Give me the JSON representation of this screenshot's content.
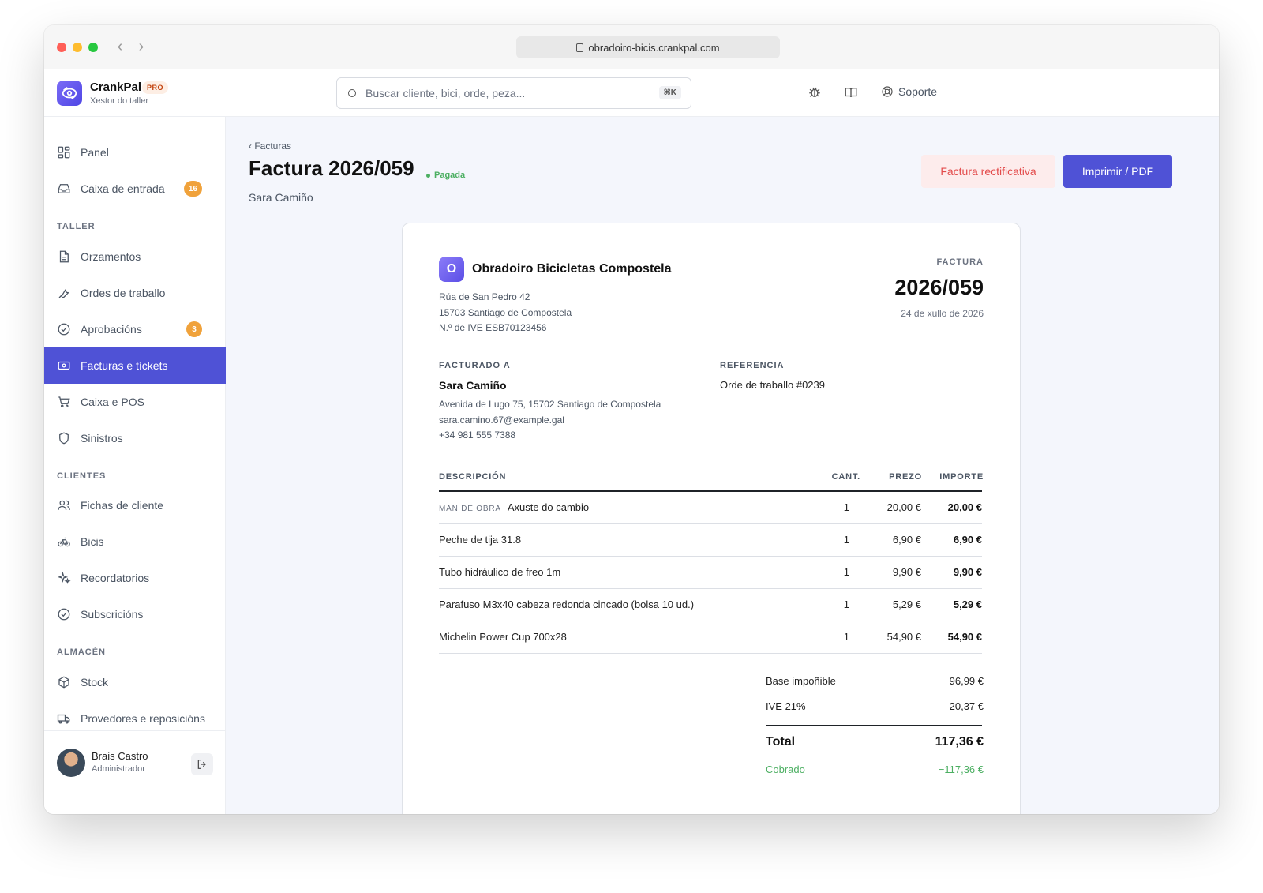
{
  "browser": {
    "url": "obradoiro-bicis.crankpal.com"
  },
  "app": {
    "name": "CrankPal",
    "plan_badge": "PRO",
    "subtitle": "Xestor do taller"
  },
  "search": {
    "placeholder": "Buscar cliente, bici, orde, peza...",
    "shortcut": "⌘K"
  },
  "header": {
    "support_label": "Soporte"
  },
  "sidebar": {
    "items": [
      {
        "label": "Panel",
        "icon": "grid-icon"
      },
      {
        "label": "Caixa de entrada",
        "icon": "inbox-icon",
        "badge": "16"
      },
      {
        "label": "Orzamentos",
        "icon": "document-icon"
      },
      {
        "label": "Ordes de traballo",
        "icon": "wrench-icon"
      },
      {
        "label": "Aprobacións",
        "icon": "check-circle-icon",
        "badge": "3"
      },
      {
        "label": "Facturas e tíckets",
        "icon": "banknote-icon",
        "active": true
      },
      {
        "label": "Caixa e POS",
        "icon": "cart-icon"
      },
      {
        "label": "Sinistros",
        "icon": "shield-icon"
      },
      {
        "label": "Fichas de cliente",
        "icon": "users-icon"
      },
      {
        "label": "Bicis",
        "icon": "bike-icon"
      },
      {
        "label": "Recordatorios",
        "icon": "sparkle-icon"
      },
      {
        "label": "Subscricións",
        "icon": "check-circle-icon"
      },
      {
        "label": "Stock",
        "icon": "box-icon"
      },
      {
        "label": "Provedores e reposicións",
        "icon": "truck-icon"
      }
    ],
    "sections": {
      "taller": "TALLER",
      "clientes": "CLIENTES",
      "almacen": "ALMACÉN"
    },
    "user": {
      "name": "Brais Castro",
      "role": "Administrador"
    }
  },
  "page": {
    "breadcrumb": "‹ Facturas",
    "title": "Factura 2026/059",
    "status": "Pagada",
    "customer": "Sara Camiño",
    "rectify_button": "Factura rectificativa",
    "print_button": "Imprimir / PDF"
  },
  "invoice": {
    "company_initial": "O",
    "company_name": "Obradoiro Bicicletas Compostela",
    "company_address_1": "Rúa de San Pedro 42",
    "company_address_2": "15703 Santiago de Compostela",
    "company_vat": "N.º de IVE ESB70123456",
    "doc_label": "FACTURA",
    "number": "2026/059",
    "date": "24 de xullo de 2026",
    "billed_to_label": "FACTURADO A",
    "billed_name": "Sara Camiño",
    "billed_address": "Avenida de Lugo 75, 15702 Santiago de Compostela",
    "billed_email": "sara.camino.67@example.gal",
    "billed_phone": "+34 981 555 7388",
    "reference_label": "REFERENCIA",
    "reference_value": "Orde de traballo #0239",
    "columns": {
      "description": "DESCRIPCIÓN",
      "qty": "CANT.",
      "price": "PREZO",
      "amount": "IMPORTE"
    },
    "lines": [
      {
        "tag": "MAN DE OBRA",
        "description": "Axuste do cambio",
        "qty": "1",
        "price": "20,00 €",
        "amount": "20,00 €"
      },
      {
        "tag": "",
        "description": "Peche de tija 31.8",
        "qty": "1",
        "price": "6,90 €",
        "amount": "6,90 €"
      },
      {
        "tag": "",
        "description": "Tubo hidráulico de freo 1m",
        "qty": "1",
        "price": "9,90 €",
        "amount": "9,90 €"
      },
      {
        "tag": "",
        "description": "Parafuso M3x40 cabeza redonda cincado (bolsa 10 ud.)",
        "qty": "1",
        "price": "5,29 €",
        "amount": "5,29 €"
      },
      {
        "tag": "",
        "description": "Michelin Power Cup 700x28",
        "qty": "1",
        "price": "54,90 €",
        "amount": "54,90 €"
      }
    ],
    "totals": {
      "base_label": "Base impoñible",
      "base_value": "96,99 €",
      "tax_label": "IVE 21%",
      "tax_value": "20,37 €",
      "total_label": "Total",
      "total_value": "117,36 €",
      "paid_label": "Cobrado",
      "paid_value": "−117,36 €"
    }
  }
}
